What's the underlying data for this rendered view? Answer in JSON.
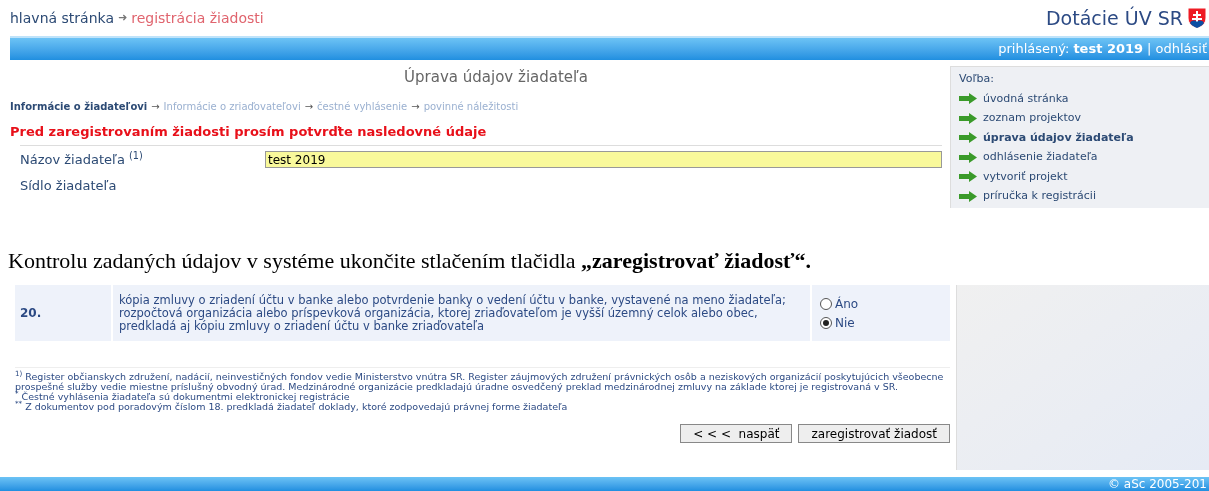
{
  "breadcrumb": [
    {
      "text": "hlavná stránka",
      "selected": false,
      "separator": "➜"
    },
    {
      "text": "registrácia žiadosti",
      "selected": true
    }
  ],
  "brand": {
    "title": "Dotácie ÚV SR"
  },
  "user_bar": {
    "label": "prihlásený:",
    "user": "test 2019",
    "separator": "|",
    "logout": "odhlásiť"
  },
  "page_title": "Úprava údajov žiadateľa",
  "steps": [
    {
      "label": "Informácie o žiadateľovi",
      "selected": true
    },
    {
      "label": "Informácie o zriaďovateľovi",
      "selected": false
    },
    {
      "label": "čestné vyhlásenie",
      "selected": false
    },
    {
      "label": "povinné náležitosti",
      "selected": false
    }
  ],
  "step_separator": "→",
  "notice": "Pred zaregistrovaním žiadosti prosím potvrďte nasledovné údaje",
  "fields": [
    {
      "kind": "input",
      "label": "Názov žiadateľa $^{(1)}$",
      "value": "test 2019"
    },
    {
      "kind": "heading",
      "label": "Sídlo žiadateľa"
    }
  ],
  "sidebar": {
    "title": "Voľba:",
    "items": [
      {
        "label": "úvodná stránka",
        "selected": false
      },
      {
        "label": "zoznam projektov",
        "selected": false
      },
      {
        "label": "úprava údajov žiadateľa",
        "selected": true
      },
      {
        "label": "odhlásenie žiadateľa",
        "selected": false
      },
      {
        "label": "vytvoriť projekt",
        "selected": false
      },
      {
        "label": "príručka k registrácii",
        "selected": false
      }
    ]
  },
  "instruction": "Kontrolu zadaných údajov v systéme ukončite stlačením tlačidla **„zaregistrovať žiadosť“.**",
  "requirement": {
    "number": "20.",
    "text": "kópia zmluvy o zriadení účtu v banke alebo potvrdenie banky o vedení účtu v banke, vystavené na meno žiadateľa; rozpočtová organizácia alebo príspevková organizácia, ktorej zriaďovateľom je vyšší územný celok alebo obec, predkladá aj kópiu zmluvy o zriadení účtu v banke zriaďovateľa",
    "options": [
      {
        "label": "Áno",
        "selected": false
      },
      {
        "label": "Nie",
        "selected": true
      }
    ]
  },
  "footnotes": [
    {
      "mark": "1)",
      "text": "Register občianskych združení, nadácií, neinvestičných fondov vedie Ministerstvo vnútra SR. Register záujmových združení právnických osôb a neziskových organizácií poskytujúcich všeobecne prospešné služby vedie miestne príslušný obvodný úrad. Medzinárodné organizácie predkladajú úradne osvedčený preklad medzinárodnej zmluvy na základe ktorej je registrovaná v SR."
    },
    {
      "mark": "*",
      "text": "Čestné vyhlásenia žiadateľa sú dokumentmi elektronickej registrácie"
    },
    {
      "mark": "**",
      "text": "Z dokumentov pod poradovým číslom 18. predkladá žiadateľ doklady, ktoré zodpovedajú právnej forme žiadateľa"
    }
  ],
  "buttons": [
    "< < <  naspäť",
    "zaregistrovať žiadosť"
  ],
  "footer": "© aSc 2005-201"
}
